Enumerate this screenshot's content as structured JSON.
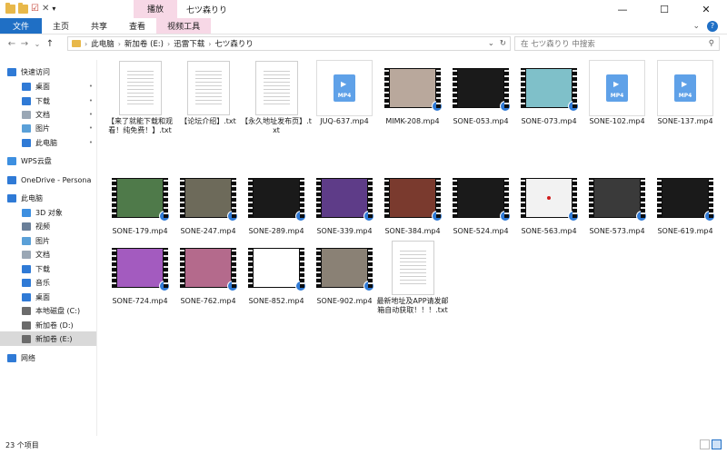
{
  "title_bar": {
    "context_tab": "播放",
    "title": "七ツ森りり",
    "controls": [
      "—",
      "☐",
      "✕"
    ]
  },
  "ribbon": {
    "tabs": [
      "文件",
      "主页",
      "共享",
      "查看",
      "视频工具"
    ],
    "expand_icon": "⌄",
    "help_icon": "?"
  },
  "address": {
    "back": "←",
    "forward": "→",
    "recent": "⌄",
    "up": "↑",
    "crumbs": [
      "此电脑",
      "新加卷 (E:)",
      "迅雷下载",
      "七ツ森りり"
    ],
    "sep": "›",
    "refresh": "↻",
    "dropdown": "⌄",
    "search_placeholder": "在 七ツ森りり 中搜索",
    "search_icon": "⚲"
  },
  "sidebar": {
    "items": [
      {
        "label": "快速访问",
        "icon": "star-icon",
        "color": "#2f7ad6"
      },
      {
        "label": "桌面",
        "icon": "desktop-icon",
        "color": "#2f7ad6",
        "pinned": true
      },
      {
        "label": "下载",
        "icon": "download-icon",
        "color": "#2f7ad6",
        "pinned": true
      },
      {
        "label": "文档",
        "icon": "document-icon",
        "color": "#9aa7b5",
        "pinned": true
      },
      {
        "label": "图片",
        "icon": "picture-icon",
        "color": "#5aa0d8",
        "pinned": true
      },
      {
        "label": "此电脑",
        "icon": "pc-icon",
        "color": "#2f7ad6",
        "pinned": true
      },
      {
        "label": "WPS云盘",
        "icon": "cloud-icon",
        "color": "#3d8fe0"
      },
      {
        "label": "OneDrive - Persona",
        "icon": "onedrive-icon",
        "color": "#2f7ad6"
      },
      {
        "label": "此电脑",
        "icon": "pc-icon",
        "color": "#2f7ad6"
      },
      {
        "label": "3D 对象",
        "icon": "cube-icon",
        "color": "#3d8fe0"
      },
      {
        "label": "视频",
        "icon": "video-icon",
        "color": "#6a7f99"
      },
      {
        "label": "图片",
        "icon": "picture-icon",
        "color": "#5aa0d8"
      },
      {
        "label": "文档",
        "icon": "document-icon",
        "color": "#9aa7b5"
      },
      {
        "label": "下载",
        "icon": "download-icon",
        "color": "#2f7ad6"
      },
      {
        "label": "音乐",
        "icon": "music-icon",
        "color": "#2f7ad6"
      },
      {
        "label": "桌面",
        "icon": "desktop-icon",
        "color": "#2f7ad6"
      },
      {
        "label": "本地磁盘 (C:)",
        "icon": "drive-icon",
        "color": "#6b6b6b"
      },
      {
        "label": "新加卷 (D:)",
        "icon": "drive-icon",
        "color": "#6b6b6b"
      },
      {
        "label": "新加卷 (E:)",
        "icon": "drive-icon",
        "color": "#6b6b6b",
        "selected": true
      },
      {
        "label": "网络",
        "icon": "network-icon",
        "color": "#2f7ad6"
      }
    ],
    "pin_glyph": "📌"
  },
  "files": [
    {
      "name": "【来了就能下载和观看！纯免费！】.txt",
      "kind": "txt"
    },
    {
      "name": "【论坛介绍】.txt",
      "kind": "txt"
    },
    {
      "name": "【永久地址发布页】.txt",
      "kind": "txt"
    },
    {
      "name": "JUQ-637.mp4",
      "kind": "mp4icon"
    },
    {
      "name": "MIMK-208.mp4",
      "kind": "video",
      "tone": "light"
    },
    {
      "name": "SONE-053.mp4",
      "kind": "video",
      "tone": "dark"
    },
    {
      "name": "SONE-073.mp4",
      "kind": "video",
      "tone": "aqua"
    },
    {
      "name": "SONE-102.mp4",
      "kind": "mp4icon"
    },
    {
      "name": "SONE-137.mp4",
      "kind": "mp4icon"
    },
    {
      "name": "SONE-179.mp4",
      "kind": "video",
      "tone": "green"
    },
    {
      "name": "SONE-247.mp4",
      "kind": "video",
      "tone": "olive"
    },
    {
      "name": "SONE-289.mp4",
      "kind": "video",
      "tone": "dark"
    },
    {
      "name": "SONE-339.mp4",
      "kind": "video",
      "tone": "purple"
    },
    {
      "name": "SONE-384.mp4",
      "kind": "video",
      "tone": "red"
    },
    {
      "name": "SONE-524.mp4",
      "kind": "video",
      "tone": "dark"
    },
    {
      "name": "SONE-563.mp4",
      "kind": "video",
      "tone": "white"
    },
    {
      "name": "SONE-573.mp4",
      "kind": "video",
      "tone": "gray"
    },
    {
      "name": "SONE-619.mp4",
      "kind": "video",
      "tone": "dark"
    },
    {
      "name": "SONE-724.mp4",
      "kind": "video",
      "tone": "stage"
    },
    {
      "name": "SONE-762.mp4",
      "kind": "video",
      "tone": "pink"
    },
    {
      "name": "SONE-852.mp4",
      "kind": "video",
      "tone": "blank"
    },
    {
      "name": "SONE-902.mp4",
      "kind": "video",
      "tone": "room"
    },
    {
      "name": "最新地址及APP请发邮箱自动获取！！！.txt",
      "kind": "txt"
    }
  ],
  "mp4_badge": "MP4",
  "tone_colors": {
    "light": "#b9a89c",
    "dark": "#1a1a1a",
    "aqua": "#7fc0c9",
    "green": "#4f7a4a",
    "olive": "#6d6a5a",
    "purple": "#5e3c88",
    "red": "#7a3a2e",
    "white": "#f2f2f2",
    "gray": "#3a3a3a",
    "stage": "#a35bbf",
    "pink": "#b46a8c",
    "blank": "#ffffff",
    "room": "#8a8175"
  },
  "status": {
    "count": "23 个项目"
  }
}
